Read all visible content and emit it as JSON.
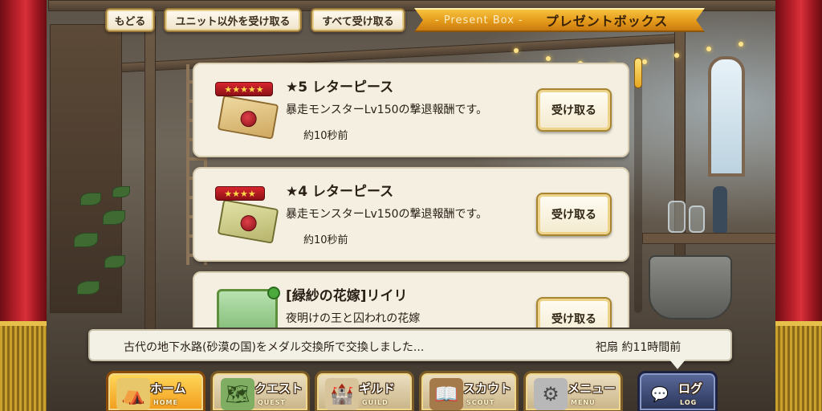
{
  "top_bar": {
    "back_label": "もどる",
    "receive_except_units_label": "ユニット以外を受け取る",
    "receive_all_label": "すべて受け取る",
    "header_en": "- Present Box -",
    "header_jp": "プレゼントボックス"
  },
  "presents": [
    {
      "rarity": "★★★★★",
      "title": "★5 レターピース",
      "description": "暴走モンスターLv150の撃退報酬です。",
      "time": "約10秒前",
      "button_label": "受け取る",
      "icon": "letter-red-icon"
    },
    {
      "rarity": "★★★★",
      "title": "★4 レターピース",
      "description": "暴走モンスターLv150の撃退報酬です。",
      "time": "約10秒前",
      "button_label": "受け取る",
      "icon": "letter-green-icon"
    },
    {
      "title": "[緑紗の花嫁]リイリ",
      "description": "夜明けの王と囚われの花嫁",
      "button_label": "受け取る",
      "icon": "unit-card-icon"
    }
  ],
  "log": {
    "message": "古代の地下水路(砂漠の国)をメダル交換所で交換しました...",
    "who_time": "祀扇 約11時間前"
  },
  "nav": [
    {
      "label": "ホーム",
      "sub": "HOME",
      "icon": "home-tent-icon"
    },
    {
      "label": "クエスト",
      "sub": "QUEST",
      "icon": "quest-map-icon"
    },
    {
      "label": "ギルド",
      "sub": "GUILD",
      "icon": "guild-castle-icon"
    },
    {
      "label": "スカウト",
      "sub": "SCOUT",
      "icon": "scout-book-icon"
    },
    {
      "label": "メニュー",
      "sub": "MENU",
      "icon": "menu-gear-icon"
    },
    {
      "label": "ログ",
      "sub": "LOG",
      "icon": "log-chat-icon"
    }
  ],
  "colors": {
    "ribbon": "#e49a1a",
    "curtain": "#b8202a",
    "active_nav": "#f29c1c",
    "log_nav": "#2a3458"
  }
}
